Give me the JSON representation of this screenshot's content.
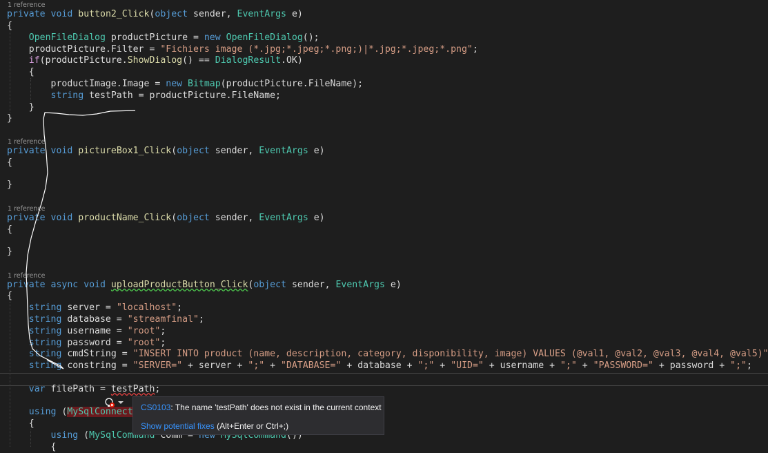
{
  "editor": {
    "lenses": [
      "1 reference",
      "1 reference",
      "1 reference",
      "1 reference"
    ],
    "lines": [
      [
        [
          "private",
          "kw"
        ],
        [
          " ",
          "plain"
        ],
        [
          "void",
          "kw"
        ],
        [
          " ",
          "plain"
        ],
        [
          "button2_Click",
          "mth"
        ],
        [
          "(",
          "punc"
        ],
        [
          "object",
          "kw"
        ],
        [
          " sender, ",
          "plain"
        ],
        [
          "EventArgs",
          "type"
        ],
        [
          " e)",
          "plain"
        ]
      ],
      [
        [
          "{",
          "punc"
        ]
      ],
      [
        [
          "    ",
          "plain"
        ],
        [
          "OpenFileDialog",
          "type"
        ],
        [
          " productPicture = ",
          "plain"
        ],
        [
          "new",
          "kw"
        ],
        [
          " ",
          "plain"
        ],
        [
          "OpenFileDialog",
          "type"
        ],
        [
          "();",
          "punc"
        ]
      ],
      [
        [
          "    productPicture.Filter = ",
          "plain"
        ],
        [
          "\"Fichiers image (*.jpg;*.jpeg;*.png;)|*.jpg;*.jpeg;*.png\"",
          "str"
        ],
        [
          ";",
          "punc"
        ]
      ],
      [
        [
          "    ",
          "plain"
        ],
        [
          "if",
          "ctl"
        ],
        [
          "(productPicture.",
          "plain"
        ],
        [
          "ShowDialog",
          "mth"
        ],
        [
          "() == ",
          "plain"
        ],
        [
          "DialogResult",
          "type"
        ],
        [
          ".OK)",
          "plain"
        ]
      ],
      [
        [
          "    {",
          "punc"
        ]
      ],
      [
        [
          "        productImage.Image = ",
          "plain"
        ],
        [
          "new",
          "kw"
        ],
        [
          " ",
          "plain"
        ],
        [
          "Bitmap",
          "type"
        ],
        [
          "(productPicture.FileName);",
          "plain"
        ]
      ],
      [
        [
          "        ",
          "plain"
        ],
        [
          "string",
          "kw"
        ],
        [
          " testPath = productPicture.FileName;",
          "plain"
        ]
      ],
      [
        [
          "    }",
          "punc"
        ]
      ],
      [
        [
          "}",
          "punc"
        ]
      ],
      [
        [
          "private",
          "kw"
        ],
        [
          " ",
          "plain"
        ],
        [
          "void",
          "kw"
        ],
        [
          " ",
          "plain"
        ],
        [
          "pictureBox1_Click",
          "mth"
        ],
        [
          "(",
          "punc"
        ],
        [
          "object",
          "kw"
        ],
        [
          " sender, ",
          "plain"
        ],
        [
          "EventArgs",
          "type"
        ],
        [
          " e)",
          "plain"
        ]
      ],
      [
        [
          "{",
          "punc"
        ]
      ],
      [
        [
          "}",
          "punc"
        ]
      ],
      [
        [
          "private",
          "kw"
        ],
        [
          " ",
          "plain"
        ],
        [
          "void",
          "kw"
        ],
        [
          " ",
          "plain"
        ],
        [
          "productName_Click",
          "mth"
        ],
        [
          "(",
          "punc"
        ],
        [
          "object",
          "kw"
        ],
        [
          " sender, ",
          "plain"
        ],
        [
          "EventArgs",
          "type"
        ],
        [
          " e)",
          "plain"
        ]
      ],
      [
        [
          "{",
          "punc"
        ]
      ],
      [
        [
          "}",
          "punc"
        ]
      ],
      [
        [
          "private",
          "kw"
        ],
        [
          " ",
          "plain"
        ],
        [
          "async",
          "kw"
        ],
        [
          " ",
          "plain"
        ],
        [
          "void",
          "kw"
        ],
        [
          " ",
          "plain"
        ],
        [
          "uploadProductButton_Click",
          "mth ul-green"
        ],
        [
          "(",
          "punc"
        ],
        [
          "object",
          "kw"
        ],
        [
          " sender, ",
          "plain"
        ],
        [
          "EventArgs",
          "type"
        ],
        [
          " e)",
          "plain"
        ]
      ],
      [
        [
          "{",
          "punc"
        ]
      ],
      [
        [
          "    ",
          "plain"
        ],
        [
          "string",
          "kw"
        ],
        [
          " server = ",
          "plain"
        ],
        [
          "\"localhost\"",
          "str"
        ],
        [
          ";",
          "punc"
        ]
      ],
      [
        [
          "    ",
          "plain"
        ],
        [
          "string",
          "kw"
        ],
        [
          " database = ",
          "plain"
        ],
        [
          "\"streamfinal\"",
          "str"
        ],
        [
          ";",
          "punc"
        ]
      ],
      [
        [
          "    ",
          "plain"
        ],
        [
          "string",
          "kw"
        ],
        [
          " username = ",
          "plain"
        ],
        [
          "\"root\"",
          "str"
        ],
        [
          ";",
          "punc"
        ]
      ],
      [
        [
          "    ",
          "plain"
        ],
        [
          "string",
          "kw"
        ],
        [
          " password = ",
          "plain"
        ],
        [
          "\"root\"",
          "str"
        ],
        [
          ";",
          "punc"
        ]
      ],
      [
        [
          "    ",
          "plain"
        ],
        [
          "string",
          "kw"
        ],
        [
          " cmdString = ",
          "plain"
        ],
        [
          "\"INSERT INTO product (name, description, category, disponibility, image) VALUES (@val1, @val2, @val3, @val4, @val5)\"",
          "str"
        ],
        [
          ";",
          "punc"
        ]
      ],
      [
        [
          "    ",
          "plain"
        ],
        [
          "string",
          "kw"
        ],
        [
          " constring = ",
          "plain"
        ],
        [
          "\"SERVER=\"",
          "str"
        ],
        [
          " + server + ",
          "plain"
        ],
        [
          "\";\"",
          "str"
        ],
        [
          " + ",
          "plain"
        ],
        [
          "\"DATABASE=\"",
          "str"
        ],
        [
          " + database + ",
          "plain"
        ],
        [
          "\";\"",
          "str"
        ],
        [
          " + ",
          "plain"
        ],
        [
          "\"UID=\"",
          "str"
        ],
        [
          " + username + ",
          "plain"
        ],
        [
          "\";\"",
          "str"
        ],
        [
          " + ",
          "plain"
        ],
        [
          "\"PASSWORD=\"",
          "str"
        ],
        [
          " + password + ",
          "plain"
        ],
        [
          "\";\"",
          "str"
        ],
        [
          ";",
          "punc"
        ]
      ],
      [
        [
          "    ",
          "plain"
        ],
        [
          "var",
          "kw"
        ],
        [
          " filePath = ",
          "plain"
        ],
        [
          "testPath",
          "plain ul-red"
        ],
        [
          ";",
          "punc"
        ]
      ],
      [
        [
          "    ",
          "plain"
        ],
        [
          "using",
          "kw"
        ],
        [
          " (",
          "plain"
        ],
        [
          "MySqlConnecti",
          "type errbg"
        ]
      ],
      [
        [
          "    {",
          "punc"
        ]
      ],
      [
        [
          "        ",
          "plain"
        ],
        [
          "using",
          "kw"
        ],
        [
          " (",
          "plain"
        ],
        [
          "MySqlCommand",
          "type"
        ],
        [
          " comm = ",
          "plain"
        ],
        [
          "new",
          "kw"
        ],
        [
          " ",
          "plain"
        ],
        [
          "MySqlCommand",
          "type"
        ],
        [
          "())",
          "plain"
        ]
      ],
      [
        [
          "        {",
          "punc"
        ]
      ]
    ]
  },
  "quick_actions": {
    "icon": "lightbulb-error-icon",
    "dropdown_icon": "chevron-down-icon"
  },
  "diagnostic": {
    "code": "CS0103",
    "message": ": The name 'testPath' does not exist in the current context",
    "fix_link": "Show potential fixes",
    "fix_shortcut": " (Alt+Enter or Ctrl+;)"
  },
  "colors": {
    "background": "#1e1e1e",
    "keyword": "#569cd6",
    "control_keyword": "#d8a0df",
    "type": "#4ec9b0",
    "string": "#d69d85",
    "method": "#dcdcaa",
    "error_squiggle": "#e04040",
    "tooltip_link": "#3794ff"
  }
}
